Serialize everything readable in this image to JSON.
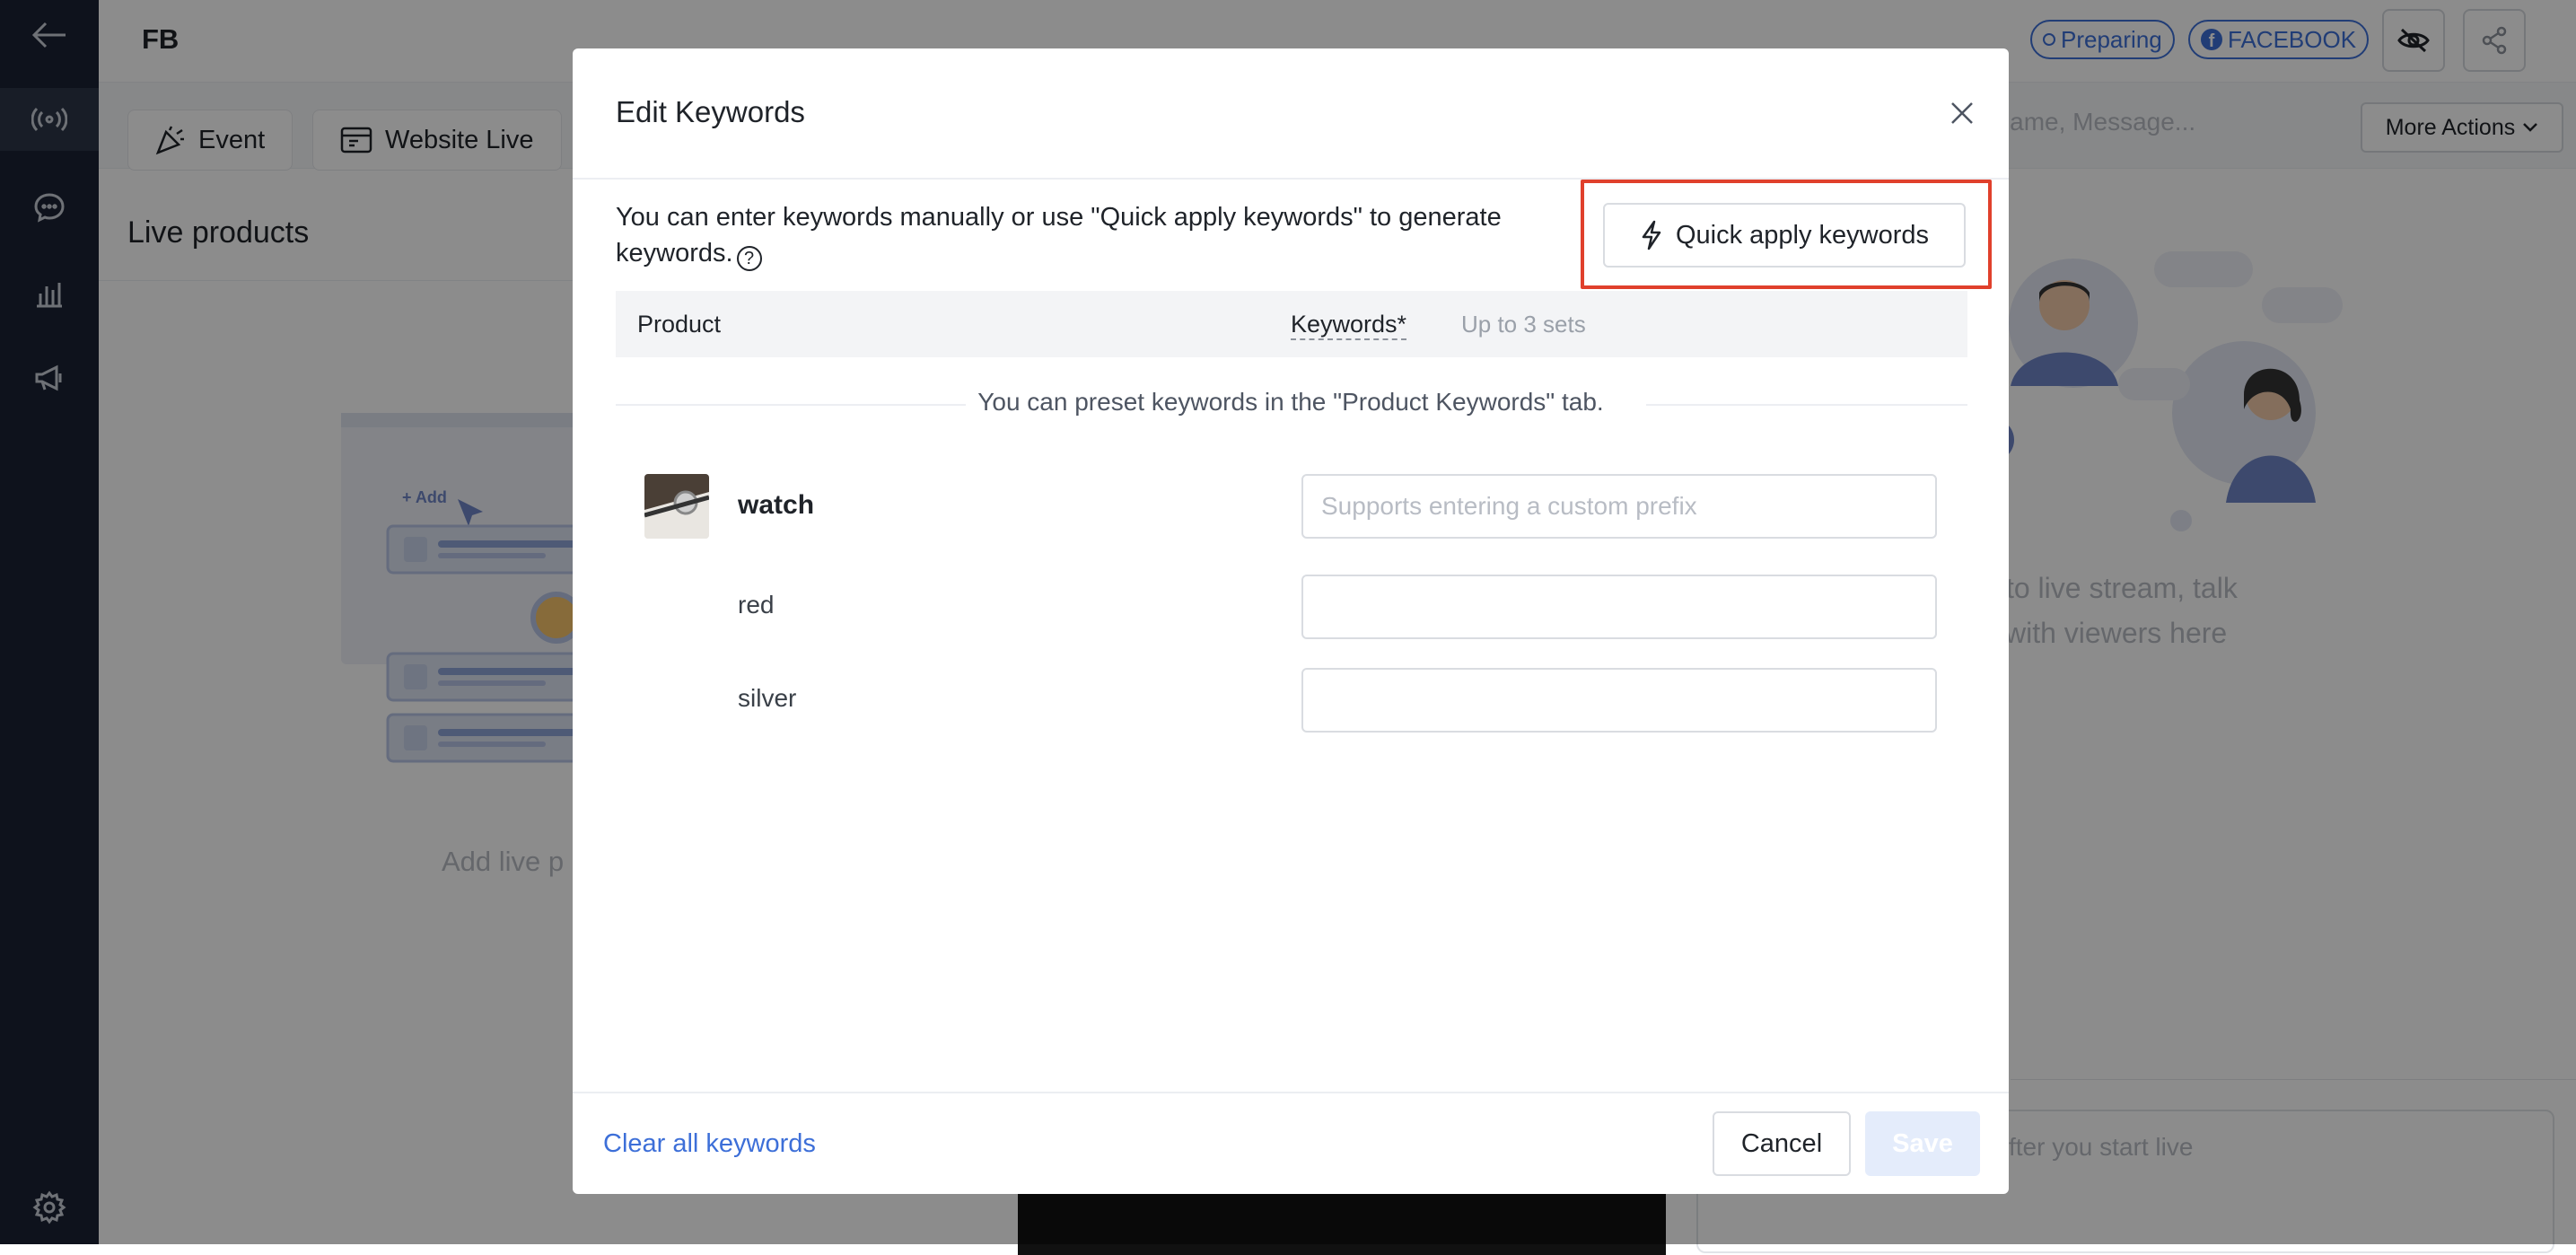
{
  "header": {
    "brand": "FB",
    "status_pill": "Preparing",
    "platform_pill": "FACEBOOK"
  },
  "toolbar": {
    "event_label": "Event",
    "website_live_label": "Website Live",
    "search_placeholder": "ustomer Name, Message...",
    "more_actions_label": "More Actions"
  },
  "left_panel": {
    "title": "Live products",
    "illustration_add": "+ Add",
    "empty_text": "Add live p"
  },
  "right_panel": {
    "empty_line1": "nected to live stream, talk",
    "empty_line2": "with viewers here",
    "comment_placeholder": "fter you start live"
  },
  "modal": {
    "title": "Edit Keywords",
    "intro": "You can enter keywords manually or use \"Quick apply keywords\" to generate keywords.",
    "quick_apply_label": "Quick apply keywords",
    "table": {
      "product_header": "Product",
      "keywords_header": "Keywords*",
      "keywords_hint": "Up to 3 sets"
    },
    "preset_hint": "You can preset keywords in the \"Product Keywords\" tab.",
    "product": {
      "name": "watch",
      "prefix_placeholder": "Supports entering a custom prefix",
      "variants": [
        {
          "name": "red",
          "keyword": ""
        },
        {
          "name": "silver",
          "keyword": ""
        }
      ]
    },
    "footer": {
      "clear_label": "Clear all keywords",
      "cancel_label": "Cancel",
      "save_label": "Save"
    }
  },
  "colors": {
    "accent": "#3d6fd8",
    "highlight": "#e0402c",
    "sidebar": "#1b2233"
  }
}
